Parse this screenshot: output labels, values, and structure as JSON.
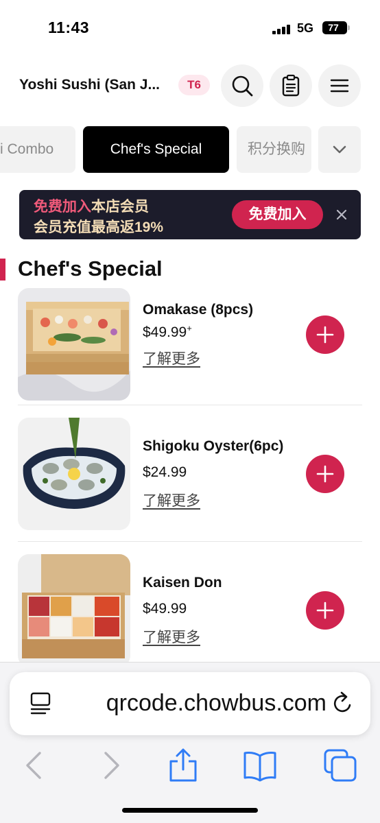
{
  "status_bar": {
    "time": "11:43",
    "network": "5G",
    "battery": "77"
  },
  "header": {
    "store_name": "Yoshi Sushi (San J...",
    "table_badge": "T6",
    "icons": [
      "search-icon",
      "order-list-icon",
      "menu-icon"
    ]
  },
  "tabs": {
    "items": [
      {
        "label": "i Combo",
        "active": false
      },
      {
        "label": "Chef's Special",
        "active": true
      },
      {
        "label": "积分换购",
        "active": false
      }
    ],
    "more_icon": "chevron-down-icon"
  },
  "banner": {
    "line1_highlight": "免费加入",
    "line1_rest": "本店会员",
    "line2": "会员充值最高返19%",
    "button": "免费加入",
    "close_icon": "close-icon"
  },
  "section": {
    "title": "Chef's Special"
  },
  "menu_items": [
    {
      "name": "Omakase (8pcs)",
      "price": "$49.99",
      "price_suffix": "+",
      "more": "了解更多"
    },
    {
      "name": "Shigoku Oyster(6pc)",
      "price": "$24.99",
      "price_suffix": "",
      "more": "了解更多"
    },
    {
      "name": "Kaisen Don",
      "price": "$49.99",
      "price_suffix": "",
      "more": "了解更多"
    }
  ],
  "browser": {
    "url": "qrcode.chowbus.com",
    "icons": [
      "reader-icon",
      "reload-icon",
      "back-icon",
      "forward-icon",
      "share-icon",
      "bookmarks-icon",
      "tabs-icon"
    ]
  },
  "colors": {
    "accent": "#d0244f",
    "banner_bg": "#1c1c2b",
    "banner_text": "#f3dcb6",
    "ios_blue": "#2f7cf6"
  }
}
